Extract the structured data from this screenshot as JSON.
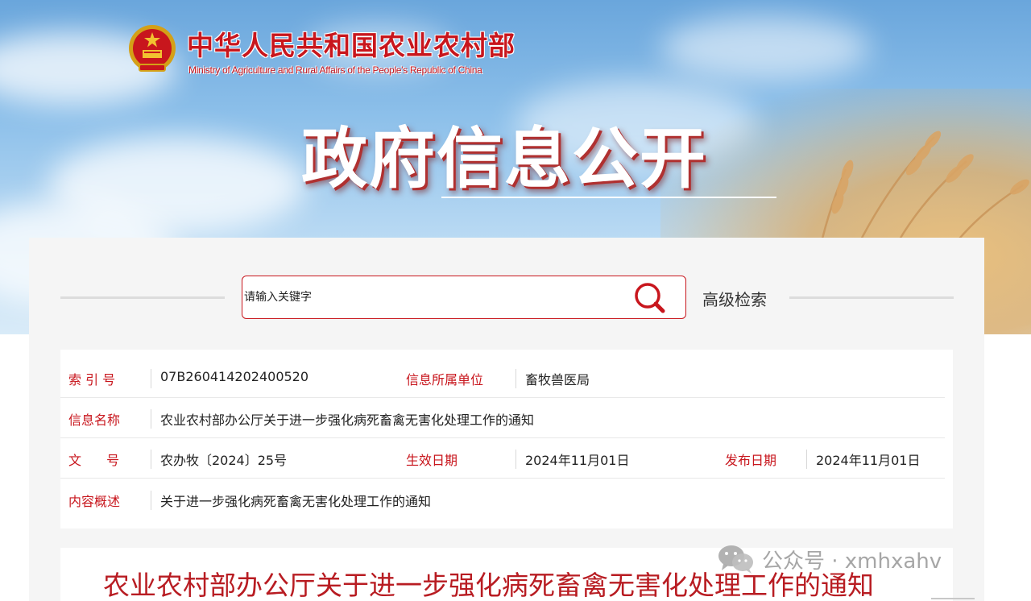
{
  "header": {
    "logo_cn": "中华人民共和国农业农村部",
    "logo_en": "Ministry of Agriculture and Rural Affairs of the People's Republic of China",
    "hero_title": "政府信息公开",
    "emblem_icon": "national-emblem-icon"
  },
  "search": {
    "placeholder": "请输入关键字",
    "search_icon": "search-icon",
    "advanced_label": "高级检索"
  },
  "info": {
    "index_label": "索 引 号",
    "index_value": "07B260414202400520",
    "unit_label": "信息所属单位",
    "unit_value": "畜牧兽医局",
    "name_label": "信息名称",
    "name_value": "农业农村部办公厅关于进一步强化病死畜禽无害化处理工作的通知",
    "doc_label": "文 号",
    "doc_value": "农办牧〔2024〕25号",
    "effective_label": "生效日期",
    "effective_value": "2024年11月01日",
    "publish_label": "发布日期",
    "publish_value": "2024年11月01日",
    "summary_label": "内容概述",
    "summary_value": "关于进一步强化病死畜禽无害化处理工作的通知"
  },
  "article": {
    "title": "农业农村部办公厅关于进一步强化病死畜禽无害化处理工作的通知"
  },
  "watermark": {
    "icon": "wechat-icon",
    "text": "公众号 · xmhxahv"
  },
  "colors": {
    "accent": "#c8161d",
    "title_red": "#b81c22",
    "panel_bg": "#f5f5f5"
  }
}
